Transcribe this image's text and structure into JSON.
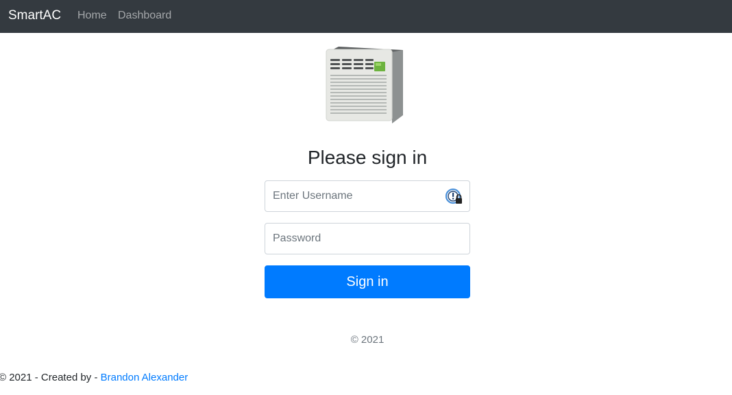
{
  "navbar": {
    "brand": "SmartAC",
    "links": [
      {
        "label": "Home"
      },
      {
        "label": "Dashboard"
      }
    ],
    "background_color": "#343a40"
  },
  "hero": {
    "image_icon": "air-conditioner-icon"
  },
  "form": {
    "heading": "Please sign in",
    "username_placeholder": "Enter Username",
    "username_value": "",
    "password_placeholder": "Password",
    "password_value": "",
    "password_manager_icon": "password-manager-icon",
    "submit_label": "Sign in",
    "accent_color": "#007bff"
  },
  "copyright": "© 2021",
  "footer": {
    "prefix": "© 2021 - Created by - ",
    "author": "Brandon Alexander",
    "link_color": "#007bff"
  }
}
